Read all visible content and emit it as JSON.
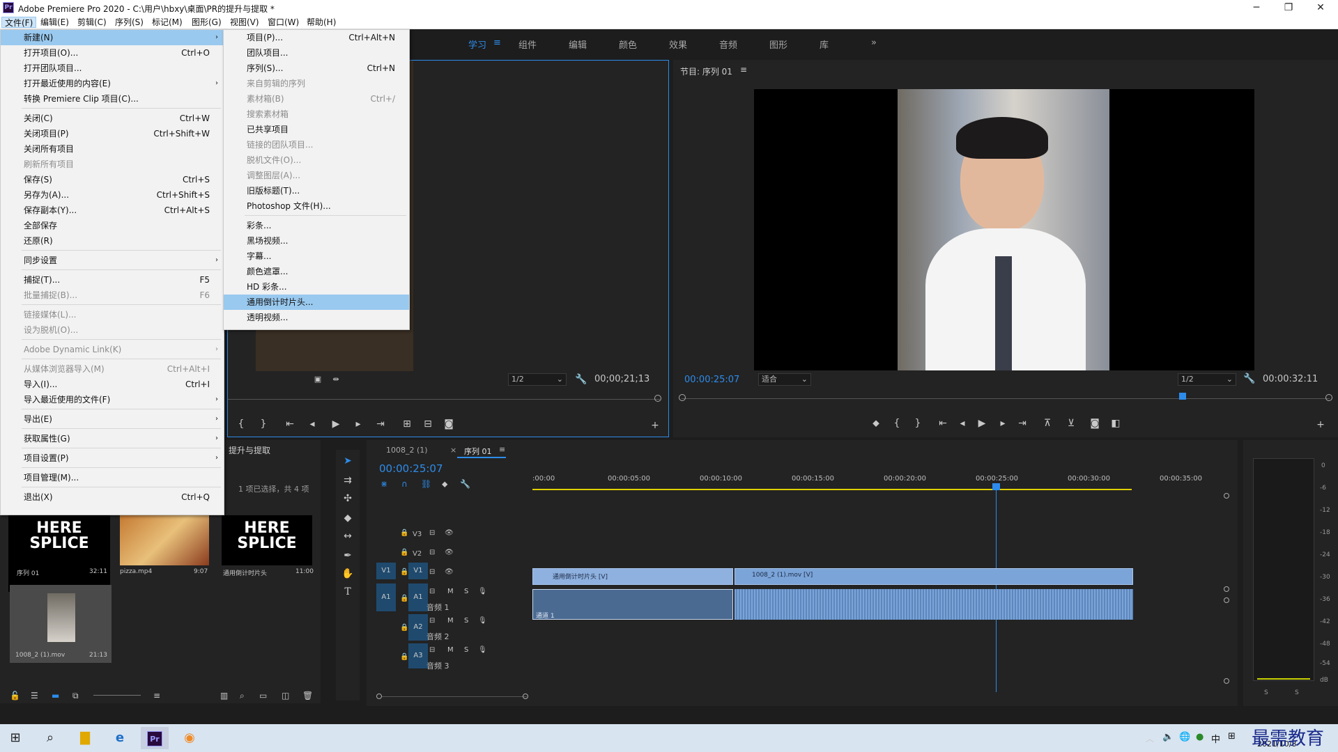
{
  "app": {
    "title": "Adobe Premiere Pro 2020 - C:\\用户\\hbxy\\桌面\\PR的提升与提取 *",
    "logo": "Pr"
  },
  "menubar": [
    "文件(F)",
    "编辑(E)",
    "剪辑(C)",
    "序列(S)",
    "标记(M)",
    "图形(G)",
    "视图(V)",
    "窗口(W)",
    "帮助(H)"
  ],
  "workspaces": [
    "学习",
    "组件",
    "编辑",
    "颜色",
    "效果",
    "音频",
    "图形",
    "库"
  ],
  "workspace_active": "学习",
  "file_menu": [
    {
      "label": "新建(N)",
      "shortcut": "",
      "arrow": true,
      "hl": true
    },
    {
      "label": "打开项目(O)...",
      "shortcut": "Ctrl+O"
    },
    {
      "label": "打开团队项目..."
    },
    {
      "label": "打开最近使用的内容(E)",
      "arrow": true
    },
    {
      "label": "转换 Premiere Clip 项目(C)..."
    },
    {
      "label": "关闭(C)",
      "shortcut": "Ctrl+W"
    },
    {
      "label": "关闭项目(P)",
      "shortcut": "Ctrl+Shift+W"
    },
    {
      "label": "关闭所有项目"
    },
    {
      "label": "刷新所有项目",
      "dis": true
    },
    {
      "label": "保存(S)",
      "shortcut": "Ctrl+S"
    },
    {
      "label": "另存为(A)...",
      "shortcut": "Ctrl+Shift+S"
    },
    {
      "label": "保存副本(Y)...",
      "shortcut": "Ctrl+Alt+S"
    },
    {
      "label": "全部保存"
    },
    {
      "label": "还原(R)"
    },
    {
      "label": "同步设置",
      "arrow": true
    },
    {
      "label": "捕捉(T)...",
      "shortcut": "F5"
    },
    {
      "label": "批量捕捉(B)...",
      "shortcut": "F6",
      "dis": true
    },
    {
      "label": "链接媒体(L)...",
      "dis": true
    },
    {
      "label": "设为脱机(O)...",
      "dis": true
    },
    {
      "label": "Adobe Dynamic Link(K)",
      "arrow": true,
      "dis": true
    },
    {
      "label": "从媒体浏览器导入(M)",
      "shortcut": "Ctrl+Alt+I",
      "dis": true
    },
    {
      "label": "导入(I)...",
      "shortcut": "Ctrl+I"
    },
    {
      "label": "导入最近使用的文件(F)",
      "arrow": true
    },
    {
      "label": "导出(E)",
      "arrow": true
    },
    {
      "label": "获取属性(G)",
      "arrow": true
    },
    {
      "label": "项目设置(P)",
      "arrow": true
    },
    {
      "label": "项目管理(M)..."
    },
    {
      "label": "退出(X)",
      "shortcut": "Ctrl+Q"
    }
  ],
  "new_submenu": [
    {
      "label": "项目(P)...",
      "shortcut": "Ctrl+Alt+N"
    },
    {
      "label": "团队项目..."
    },
    {
      "label": "序列(S)...",
      "shortcut": "Ctrl+N"
    },
    {
      "label": "来自剪辑的序列",
      "dis": true
    },
    {
      "label": "素材箱(B)",
      "shortcut": "Ctrl+/",
      "dis": true
    },
    {
      "label": "搜索素材箱",
      "dis": true
    },
    {
      "label": "已共享项目"
    },
    {
      "label": "链接的团队项目...",
      "dis": true
    },
    {
      "label": "脱机文件(O)...",
      "dis": true
    },
    {
      "label": "调整图层(A)...",
      "dis": true
    },
    {
      "label": "旧版标题(T)..."
    },
    {
      "label": "Photoshop 文件(H)..."
    },
    {
      "label": "彩条..."
    },
    {
      "label": "黑场视频..."
    },
    {
      "label": "字幕..."
    },
    {
      "label": "颜色遮罩..."
    },
    {
      "label": "HD 彩条..."
    },
    {
      "label": "通用倒计时片头...",
      "hl": true
    },
    {
      "label": "透明视频..."
    }
  ],
  "source_monitor": {
    "zoom": "1/2",
    "timecode": "00;00;21;13"
  },
  "program_monitor": {
    "title": "节目: 序列 01",
    "timecode": "00:00:25:07",
    "fit": "适合",
    "zoom": "1/2",
    "duration": "00:00:32:11"
  },
  "project_panel": {
    "title": "提升与提取",
    "selection": "1 项已选择，共 4 项",
    "items": [
      {
        "name": "序列 01",
        "duration": "32:11",
        "thumb": "HERE SPLICE"
      },
      {
        "name": "pizza.mp4",
        "duration": "9:07",
        "thumb": "pizza"
      },
      {
        "name": "通用倒计时片头",
        "duration": "11:00",
        "thumb": "HERE SPLICE"
      },
      {
        "name": "1008_2 (1).mov",
        "duration": "21:13",
        "thumb": "person"
      }
    ]
  },
  "timeline": {
    "tabs": [
      "1008_2 (1)",
      "序列 01"
    ],
    "active_tab": "序列 01",
    "timecode": "00:00:25:07",
    "ruler": [
      ":00:00",
      "00:00:05:00",
      "00:00:10:00",
      "00:00:15:00",
      "00:00:20:00",
      "00:00:25:00",
      "00:00:30:00",
      "00:00:35:00"
    ],
    "tracks": [
      {
        "id": "V3",
        "kind": "video"
      },
      {
        "id": "V2",
        "kind": "video"
      },
      {
        "id": "V1",
        "kind": "video",
        "src": "V1"
      },
      {
        "id": "A1",
        "kind": "audio",
        "src": "A1",
        "name": "音频 1"
      },
      {
        "id": "A2",
        "kind": "audio",
        "name": "音频 2"
      },
      {
        "id": "A3",
        "kind": "audio",
        "name": "音频 3"
      }
    ],
    "clips": {
      "v1a": "通用倒计时片头 [V]",
      "v1b": "1008_2 (1).mov [V]",
      "a1a": "通道 1"
    },
    "track_btn_m": "M",
    "track_btn_s": "S"
  },
  "audio_meter": {
    "scale": [
      "0",
      "-6",
      "-12",
      "-18",
      "-24",
      "-30",
      "-36",
      "-42",
      "-48",
      "-54",
      "dB"
    ],
    "solo": [
      "S",
      "S"
    ]
  },
  "taskbar": {
    "ime": "中",
    "date": "2021/10/8",
    "watermark": "最需教育"
  }
}
